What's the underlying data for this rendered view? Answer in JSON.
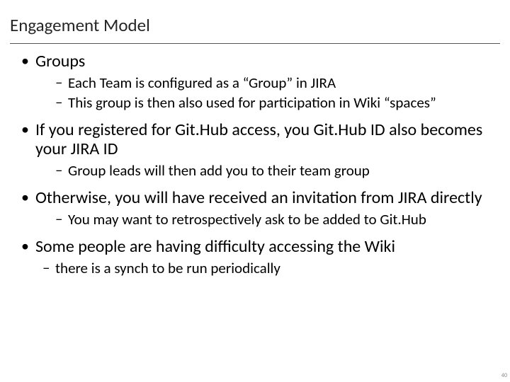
{
  "title": "Engagement Model",
  "bullets": [
    {
      "text": "Groups",
      "sub": [
        "Each Team is configured as a “Group” in JIRA",
        "This group is then also used for participation in Wiki “spaces”"
      ]
    },
    {
      "text": "If you registered for Git.Hub access, you Git.Hub ID also becomes your JIRA ID",
      "sub": [
        "Group leads will then add you to their team group"
      ]
    },
    {
      "text": "Otherwise, you will have received an invitation from JIRA directly",
      "sub": [
        "You may want to retrospectively ask to be added to Git.Hub"
      ]
    },
    {
      "text": "Some people are having difficulty accessing the Wiki",
      "sub": [
        "there is a synch to be run periodically"
      ]
    }
  ],
  "page_number": "40"
}
